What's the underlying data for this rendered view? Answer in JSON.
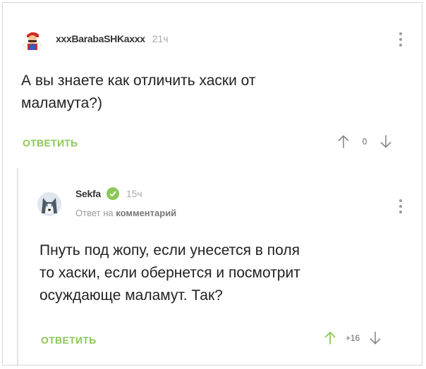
{
  "comment": {
    "username": "xxxBarabaSHKaxxx",
    "time": "21ч",
    "text_line1": "А вы знаете как отличить хаски от",
    "text_line2": "маламута?)",
    "reply_label": "ОТВЕТИТЬ",
    "score": "0"
  },
  "reply": {
    "username": "Sekfa",
    "time": "15ч",
    "reply_to_prefix": "Ответ на",
    "reply_to_target": "комментарий",
    "text_line1": "Пнуть под жопу, если унесется в поля",
    "text_line2": "то хаски, если обернется и посмотрит",
    "text_line3": "осуждающе маламут. Так?",
    "reply_label": "ОТВЕТИТЬ",
    "score": "+16"
  },
  "colors": {
    "accent": "#8ac858",
    "upvoted": "#8ac858",
    "muted": "#aaaaaa",
    "text": "#222222"
  },
  "icons": [
    "mario-avatar-icon",
    "husky-avatar-icon",
    "verified-check-icon",
    "arrow-up-icon",
    "arrow-down-icon",
    "kebab-menu-icon"
  ]
}
